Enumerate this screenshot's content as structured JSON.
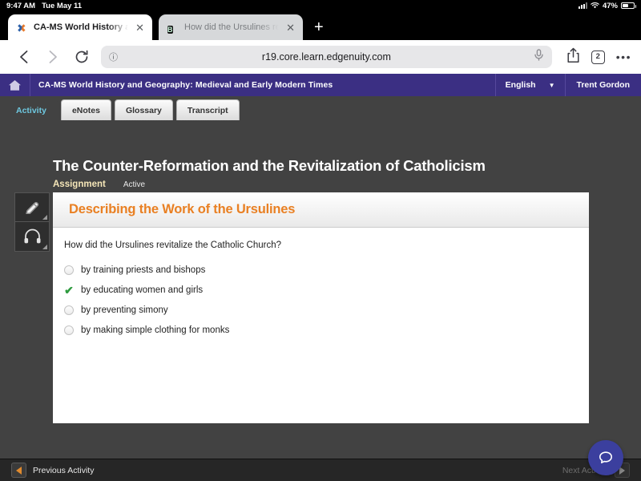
{
  "status_bar": {
    "time": "9:47 AM",
    "date": "Tue May 11",
    "battery_percent": "47%",
    "signal_icon": "cellular-signal-icon",
    "wifi_icon": "wifi-icon",
    "battery_icon": "battery-icon"
  },
  "browser": {
    "tabs": [
      {
        "title": "CA-MS World History and",
        "favicon": "edgenuity-x-favicon",
        "favicon_text": "✖",
        "active": true,
        "close_label": "✕"
      },
      {
        "title": "How did the Ursulines rev",
        "favicon": "brainly-b-favicon",
        "favicon_text": "B",
        "active": false,
        "close_label": "✕"
      }
    ],
    "new_tab_label": "+",
    "back_label": "←",
    "forward_label": "→",
    "reload_label": "⟳",
    "aa_label": "ⓘ",
    "url": "r19.core.learn.edgenuity.com",
    "mic_icon": "microphone-icon",
    "share_icon": "share-icon",
    "tab_count": "2",
    "more_label": "•••"
  },
  "app_header": {
    "home_icon": "home-icon",
    "course_title": "CA-MS World History and Geography: Medieval and Early Modern Times",
    "language": "English",
    "language_caret": "❯",
    "user_name": "Trent Gordon"
  },
  "activity_tabs": [
    {
      "label": "Activity",
      "active": true
    },
    {
      "label": "eNotes",
      "active": false
    },
    {
      "label": "Glossary",
      "active": false
    },
    {
      "label": "Transcript",
      "active": false
    }
  ],
  "lesson": {
    "title": "The Counter-Reformation and the Revitalization of Catholicism",
    "type_label": "Assignment",
    "status_label": "Active"
  },
  "tools": [
    {
      "name": "highlighter-tool",
      "icon": "pencil-icon"
    },
    {
      "name": "audio-tool",
      "icon": "headphones-icon"
    }
  ],
  "card": {
    "heading": "Describing the Work of the Ursulines",
    "question": "How did the Ursulines revitalize the Catholic Church?",
    "options": [
      {
        "label": "by training priests and bishops",
        "selected": false
      },
      {
        "label": "by educating women and girls",
        "selected": true
      },
      {
        "label": "by preventing simony",
        "selected": false
      },
      {
        "label": "by making simple clothing for monks",
        "selected": false
      }
    ],
    "check_glyph": "✔"
  },
  "bottom_bar": {
    "previous_label": "Previous Activity",
    "next_label": "Next Activity"
  },
  "chat": {
    "icon": "chat-bubble-icon"
  },
  "colors": {
    "header_purple": "#3b2f83",
    "page_gray": "#424242",
    "accent_orange": "#e98023",
    "active_tab_cyan": "#6ec8e0",
    "check_green": "#2e9b3f",
    "fab_indigo": "#3b3f9e"
  }
}
